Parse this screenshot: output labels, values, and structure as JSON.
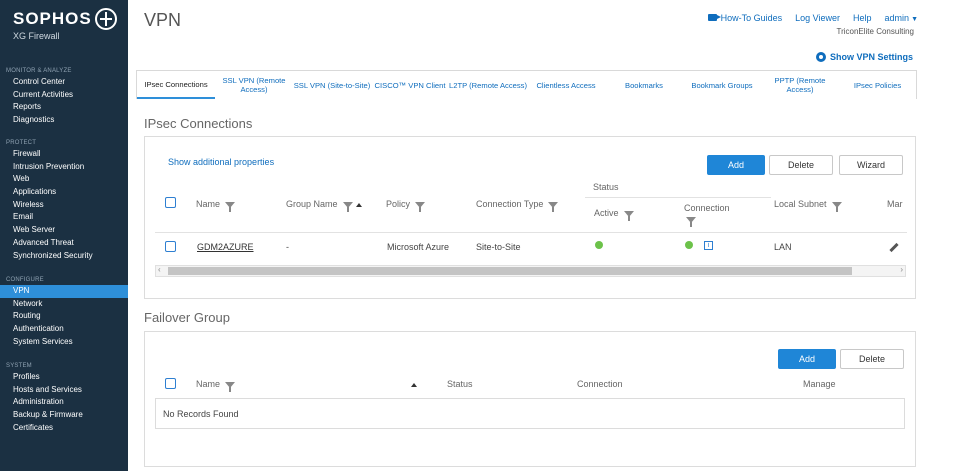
{
  "brand": {
    "name": "SOPHOS",
    "product": "XG Firewall"
  },
  "sidebar": {
    "sections": [
      {
        "heading": "MONITOR & ANALYZE",
        "items": [
          "Control Center",
          "Current Activities",
          "Reports",
          "Diagnostics"
        ]
      },
      {
        "heading": "PROTECT",
        "items": [
          "Firewall",
          "Intrusion Prevention",
          "Web",
          "Applications",
          "Wireless",
          "Email",
          "Web Server",
          "Advanced Threat",
          "Synchronized Security"
        ]
      },
      {
        "heading": "CONFIGURE",
        "items": [
          "VPN",
          "Network",
          "Routing",
          "Authentication",
          "System Services"
        ]
      },
      {
        "heading": "SYSTEM",
        "items": [
          "Profiles",
          "Hosts and Services",
          "Administration",
          "Backup & Firmware",
          "Certificates"
        ]
      }
    ],
    "active": "VPN"
  },
  "header": {
    "title": "VPN",
    "links": {
      "howto": "How-To Guides",
      "logviewer": "Log Viewer",
      "help": "Help",
      "admin": "admin"
    },
    "company": "TriconElite Consulting",
    "show_settings": "Show VPN Settings"
  },
  "tabs": [
    {
      "label": "IPsec Connections",
      "active": true
    },
    {
      "label": "SSL VPN (Remote Access)"
    },
    {
      "label": "SSL VPN (Site-to-Site)"
    },
    {
      "label": "CISCO™ VPN Client"
    },
    {
      "label": "L2TP (Remote Access)"
    },
    {
      "label": "Clientless Access"
    },
    {
      "label": "Bookmarks"
    },
    {
      "label": "Bookmark Groups"
    },
    {
      "label": "PPTP (Remote Access)"
    },
    {
      "label": "IPsec Policies"
    }
  ],
  "ipsec": {
    "title": "IPsec Connections",
    "show_props": "Show additional properties",
    "buttons": {
      "add": "Add",
      "delete": "Delete",
      "wizard": "Wizard"
    },
    "columns": {
      "name": "Name",
      "group": "Group Name",
      "policy": "Policy",
      "type": "Connection Type",
      "status": "Status",
      "active": "Active",
      "connection": "Connection",
      "subnet": "Local Subnet",
      "manage": "Mar"
    },
    "rows": [
      {
        "name": "GDM2AZURE",
        "group": "-",
        "policy": "Microsoft Azure",
        "type": "Site-to-Site",
        "subnet": "LAN"
      }
    ]
  },
  "failover": {
    "title": "Failover Group",
    "buttons": {
      "add": "Add",
      "delete": "Delete"
    },
    "columns": {
      "name": "Name",
      "status": "Status",
      "connection": "Connection",
      "manage": "Manage"
    },
    "empty": "No Records Found"
  },
  "colors": {
    "sidebar": "#1b3042",
    "accent": "#2e8fd9",
    "status_ok": "#6cc24a",
    "link": "#0f6dbd"
  }
}
